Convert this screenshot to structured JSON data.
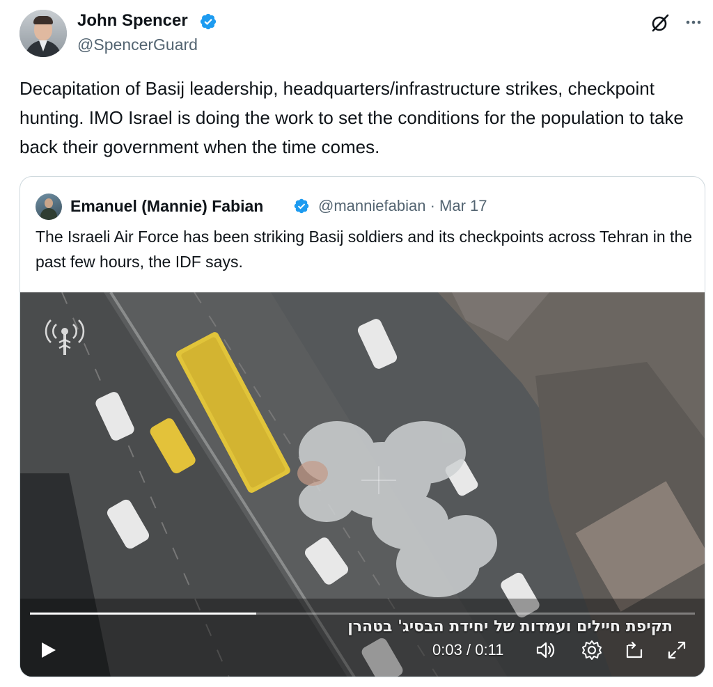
{
  "tweet": {
    "author_name": "John Spencer",
    "author_handle": "@SpencerGuard",
    "text": "Decapitation of Basij leadership, headquarters/infrastructure strikes, checkpoint hunting. IMO Israel is doing the work to set the conditions for the population to take back their government when the time comes."
  },
  "quoted": {
    "author_name": "Emanuel (Mannie) Fabian",
    "author_handle": "@manniefabian",
    "separator": "·",
    "date": "Mar 17",
    "text": "The Israeli Air Force has been striking Basij soldiers and its checkpoints across Tehran in the past few hours, the IDF says.",
    "video": {
      "caption": "תקיפת חיילים ועמדות של יחידת הבסיג' בטהרן",
      "current_time": "0:03",
      "duration": "0:11",
      "time_separator": "/",
      "progress": 0.34
    }
  },
  "icons": {
    "verified": "verified-badge-icon",
    "grok": "grok-icon",
    "more": "more-icon",
    "play": "play-icon",
    "volume": "volume-icon",
    "settings": "settings-icon",
    "pip": "picture-in-picture-icon",
    "fullscreen": "fullscreen-icon"
  },
  "colors": {
    "verified_blue": "#1d9bf0",
    "secondary_text": "#536471",
    "border": "#cfd9de"
  }
}
